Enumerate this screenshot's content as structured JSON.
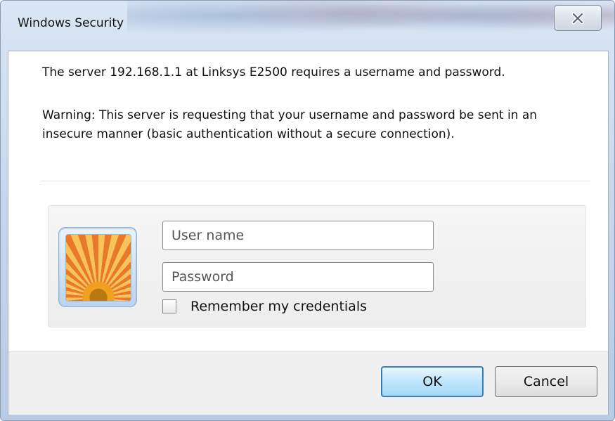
{
  "window": {
    "title": "Windows Security",
    "close_icon": "close-icon"
  },
  "message": {
    "server_line": "The server 192.168.1.1 at Linksys E2500 requires a username and password.",
    "warning": "Warning: This server is requesting that your username and password be sent in an insecure manner (basic authentication without a secure connection)."
  },
  "credentials": {
    "avatar_icon": "user-tile-flower-icon",
    "username": {
      "value": "",
      "placeholder": "User name"
    },
    "password": {
      "value": "",
      "placeholder": "Password"
    },
    "remember": {
      "label": "Remember my credentials",
      "checked": false
    }
  },
  "buttons": {
    "ok_label": "OK",
    "cancel_label": "Cancel"
  },
  "colors": {
    "ok_border": "#3c7fb1",
    "title_bar": "#c3d4ea"
  }
}
